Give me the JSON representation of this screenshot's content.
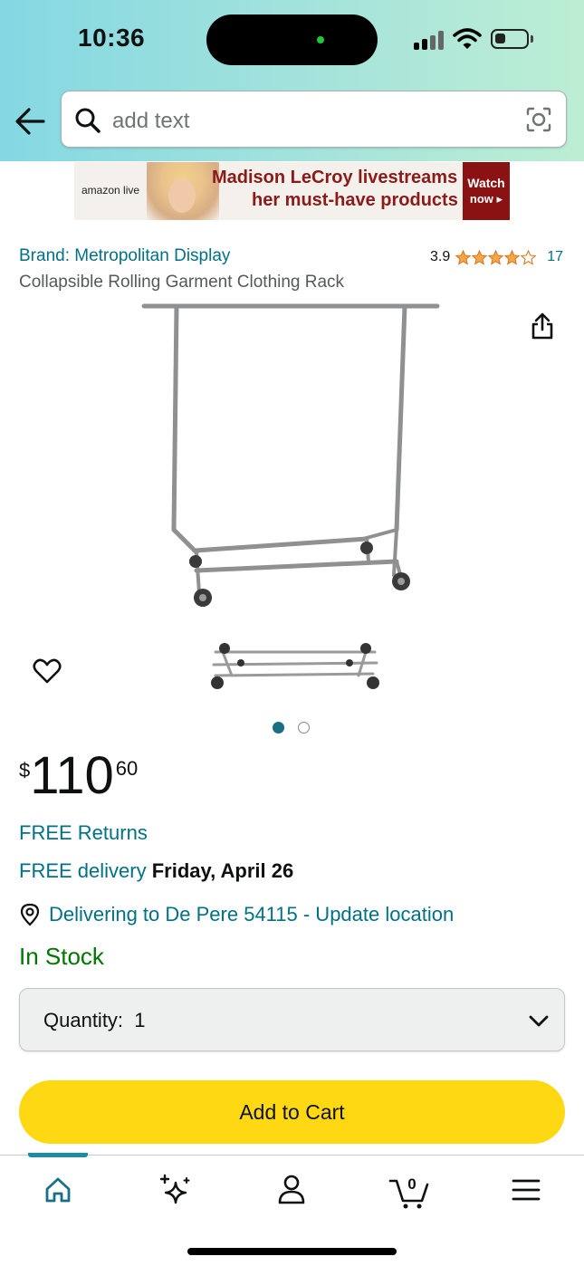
{
  "status_bar": {
    "time": "10:36"
  },
  "search": {
    "placeholder": "add text"
  },
  "ad": {
    "logo": "amazon live",
    "line1": "Madison LeCroy livestreams",
    "line2": "her must-have products",
    "cta_line1": "Watch",
    "cta_line2": "now ▸"
  },
  "product": {
    "brand": "Brand: Metropolitan Display",
    "title": "Collapsible Rolling Garment Clothing Rack",
    "rating": "3.9",
    "stars": 3.9,
    "review_count": "17",
    "image_count": 2,
    "active_image": 1
  },
  "price": {
    "symbol": "$",
    "whole": "110",
    "fraction": "60"
  },
  "shipping": {
    "returns": "FREE Returns",
    "delivery_prefix": "FREE delivery",
    "delivery_date": "Friday, April 26",
    "location": "Delivering to De Pere 54115 - Update location",
    "stock": "In Stock"
  },
  "quantity": {
    "label": "Quantity:",
    "value": "1"
  },
  "actions": {
    "add_to_cart": "Add to Cart"
  },
  "tabbar": {
    "items": [
      "home",
      "rufus",
      "account",
      "cart",
      "menu"
    ],
    "active": "home",
    "cart_count": "0"
  },
  "colors": {
    "link": "#007185",
    "stock": "#007600",
    "cart_button": "#ffd814",
    "accent": "#1a8ea0",
    "star": "#f3a847"
  }
}
